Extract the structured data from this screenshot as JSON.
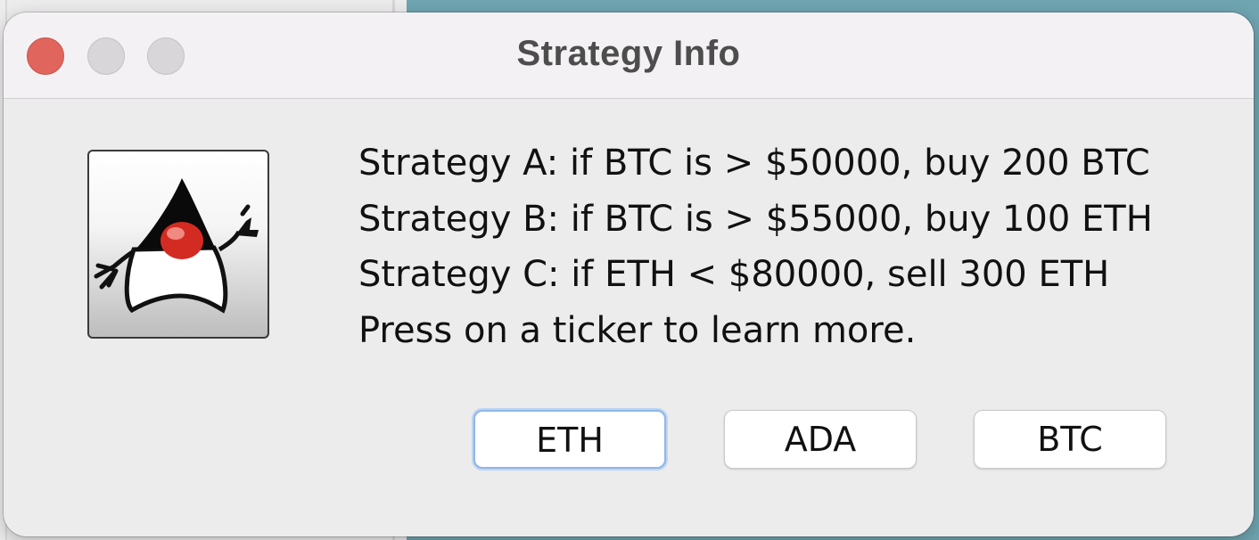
{
  "dialog": {
    "title": "Strategy Info",
    "icon": "java-duke-icon",
    "message_lines": [
      "Strategy A: if BTC is > $50000, buy 200 BTC",
      "Strategy B: if BTC is > $55000, buy 100 ETH",
      "Strategy C: if ETH < $80000, sell 300 ETH",
      "Press on a ticker to learn more."
    ],
    "buttons": [
      "ETH",
      "ADA",
      "BTC"
    ]
  },
  "colors": {
    "close": "#e0655d",
    "inactive_traffic": "#d8d6d8",
    "focus_ring": "#8fb6e6",
    "background_window": "#6fa5b1"
  }
}
